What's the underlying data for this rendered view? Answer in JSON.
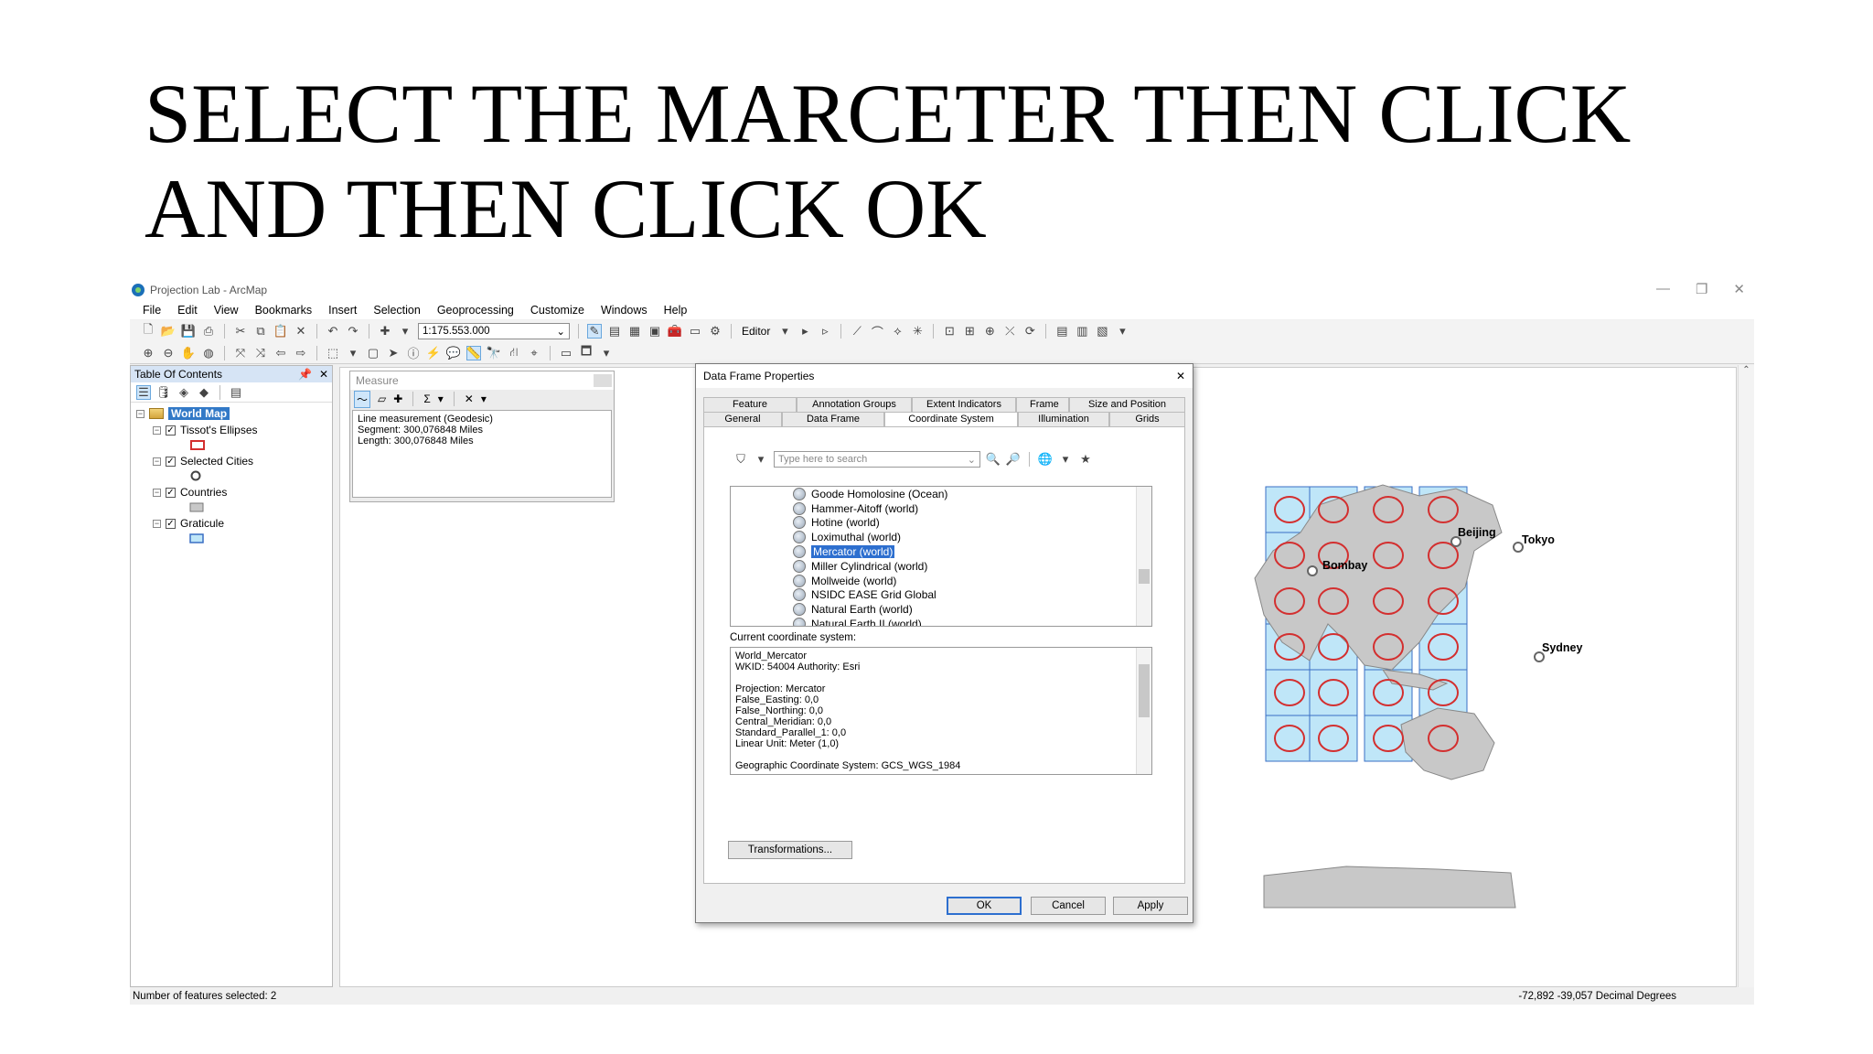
{
  "slide": {
    "title_line1": "SELECT THE MARCETER THEN CLICK",
    "title_line2": "AND THEN CLICK OK"
  },
  "app": {
    "window_title": "Projection Lab - ArcMap",
    "menus": [
      "File",
      "Edit",
      "View",
      "Bookmarks",
      "Insert",
      "Selection",
      "Geoprocessing",
      "Customize",
      "Windows",
      "Help"
    ],
    "scale": "1:175.553.000",
    "editor_label": "Editor"
  },
  "toc": {
    "title": "Table Of Contents",
    "root": "World Map",
    "layers": [
      {
        "name": "Tissot's Ellipses",
        "symbol": "red-ellipse"
      },
      {
        "name": "Selected Cities",
        "symbol": "grey-circle"
      },
      {
        "name": "Countries",
        "symbol": "grey-polygon"
      },
      {
        "name": "Graticule",
        "symbol": "blue-rectangle"
      }
    ]
  },
  "measure": {
    "title": "Measure",
    "result_line1": "Line measurement (Geodesic)",
    "result_line2": "Segment: 300,076848 Miles",
    "result_line3": "Length: 300,076848 Miles"
  },
  "map": {
    "cities": [
      "Beijing",
      "Tokyo",
      "Bombay",
      "Sydney"
    ],
    "colors": {
      "ocean": "#bfe6f8",
      "land": "#c8c8c8",
      "ellipse": "#d32f2f",
      "grid": "#3a6fc4"
    }
  },
  "dialog": {
    "title": "Data Frame Properties",
    "tabs_row1": [
      "Feature Cache",
      "Annotation Groups",
      "Extent Indicators",
      "Frame",
      "Size and Position"
    ],
    "tabs_row2": [
      "General",
      "Data Frame",
      "Coordinate System",
      "Illumination",
      "Grids"
    ],
    "selected_tab": "Coordinate System",
    "search_placeholder": "Type here to search",
    "projections": [
      "Goode Homolosine (Ocean)",
      "Hammer-Aitoff (world)",
      "Hotine (world)",
      "Loximuthal (world)",
      "Mercator (world)",
      "Miller Cylindrical (world)",
      "Mollweide (world)",
      "NSIDC EASE Grid Global",
      "Natural Earth (world)",
      "Natural Earth II (world)"
    ],
    "selected_projection": "Mercator (world)",
    "current_cs_label": "Current coordinate system:",
    "cs_lines": [
      "World_Mercator",
      "WKID: 54004 Authority: Esri",
      "",
      "Projection: Mercator",
      "False_Easting: 0,0",
      "False_Northing: 0,0",
      "Central_Meridian: 0,0",
      "Standard_Parallel_1: 0,0",
      "Linear Unit: Meter (1,0)",
      "",
      "Geographic Coordinate System: GCS_WGS_1984"
    ],
    "transformations_button": "Transformations...",
    "ok_button": "OK",
    "cancel_button": "Cancel",
    "apply_button": "Apply"
  },
  "status": {
    "left": "Number of features selected: 2",
    "right": "-72,892  -39,057 Decimal Degrees"
  }
}
